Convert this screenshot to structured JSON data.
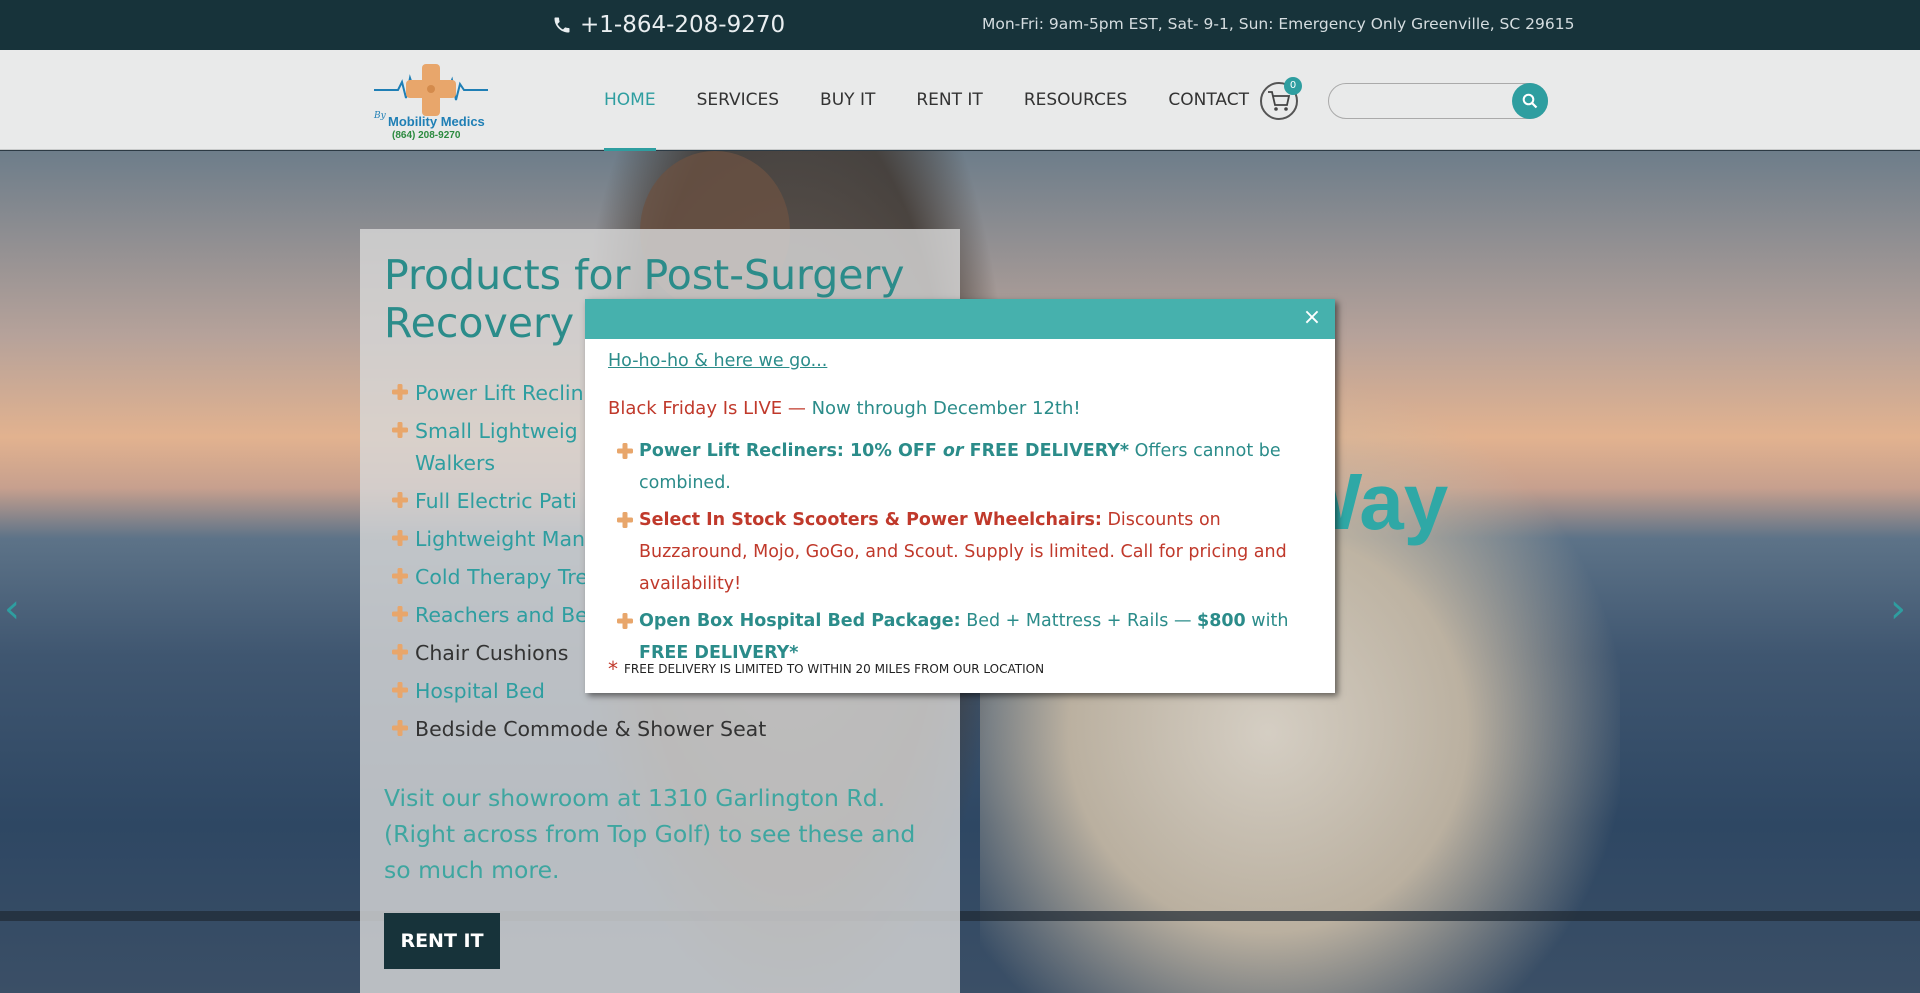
{
  "topbar": {
    "phone": "+1-864-208-9270",
    "hours": "Mon-Fri: 9am-5pm EST, Sat- 9-1, Sun: Emergency Only Greenville, SC 29615"
  },
  "header": {
    "logo": {
      "by": "By",
      "name": "Mobility Medics",
      "phone": "(864) 208-9270"
    },
    "nav": [
      {
        "label": "HOME",
        "active": true
      },
      {
        "label": "SERVICES",
        "active": false
      },
      {
        "label": "BUY IT",
        "active": false
      },
      {
        "label": "RENT IT",
        "active": false
      },
      {
        "label": "RESOURCES",
        "active": false
      },
      {
        "label": "CONTACT",
        "active": false
      }
    ],
    "cart_count": "0",
    "search": {
      "value": "",
      "placeholder": ""
    }
  },
  "hero": {
    "slogan": "ty My Way",
    "arrow_left": "‹",
    "arrow_right": "›",
    "panel": {
      "title": "Products for Post-Surgery Recovery",
      "products": [
        {
          "label": "Power Lift Reclin",
          "dark": false
        },
        {
          "label": "Small Lightweig",
          "dark": false
        },
        {
          "label": "Walkers",
          "dark": false,
          "continuation": true
        },
        {
          "label": "Full Electric Pati",
          "dark": false
        },
        {
          "label": "Lightweight Man",
          "dark": false
        },
        {
          "label": "Cold Therapy Tre",
          "dark": false
        },
        {
          "label": "Reachers and Be",
          "dark": false
        },
        {
          "label": "Chair Cushions",
          "dark": true
        },
        {
          "label": "Hospital Bed",
          "dark": false
        },
        {
          "label": "Bedside Commode & Shower Seat",
          "dark": true
        }
      ],
      "visit_text": "Visit our showroom at 1310 Garlington Rd. (Right across from Top Golf) to see these and so much more.",
      "rent_button": "RENT IT"
    }
  },
  "popup": {
    "close": "×",
    "link": "Ho-ho-ho & here we go...",
    "headline_red": "Black Friday Is LIVE",
    "headline_sep": " — ",
    "headline_teal": "Now through December 12th!",
    "offers": {
      "o1_bold": "Power Lift Recliners: 10% OFF ",
      "o1_or": "or",
      "o1_bold2": " FREE DELIVERY*",
      "o1_rest": " Offers cannot be combined.",
      "o2_bold": "Select In Stock Scooters & Power Wheelchairs:",
      "o2_rest": " Discounts on Buzzaround, Mojo, GoGo, and Scout. Supply is limited.  Call for pricing and availability!",
      "o3_bold": "Open Box Hospital Bed Package:",
      "o3_mid": " Bed + Mattress + Rails — ",
      "o3_price": "$800",
      "o3_with": " with ",
      "o3_free": "FREE DELIVERY*"
    },
    "fineprint_star": "*",
    "fineprint": "FREE DELIVERY IS LIMITED TO WITHIN 20 MILES FROM OUR LOCATION"
  },
  "colors": {
    "accent": "#2e9ea0",
    "topbar": "#17333a",
    "popup_header": "#46b1ad",
    "alert_red": "#c0392b",
    "cross_orange": "#e8a66b"
  }
}
